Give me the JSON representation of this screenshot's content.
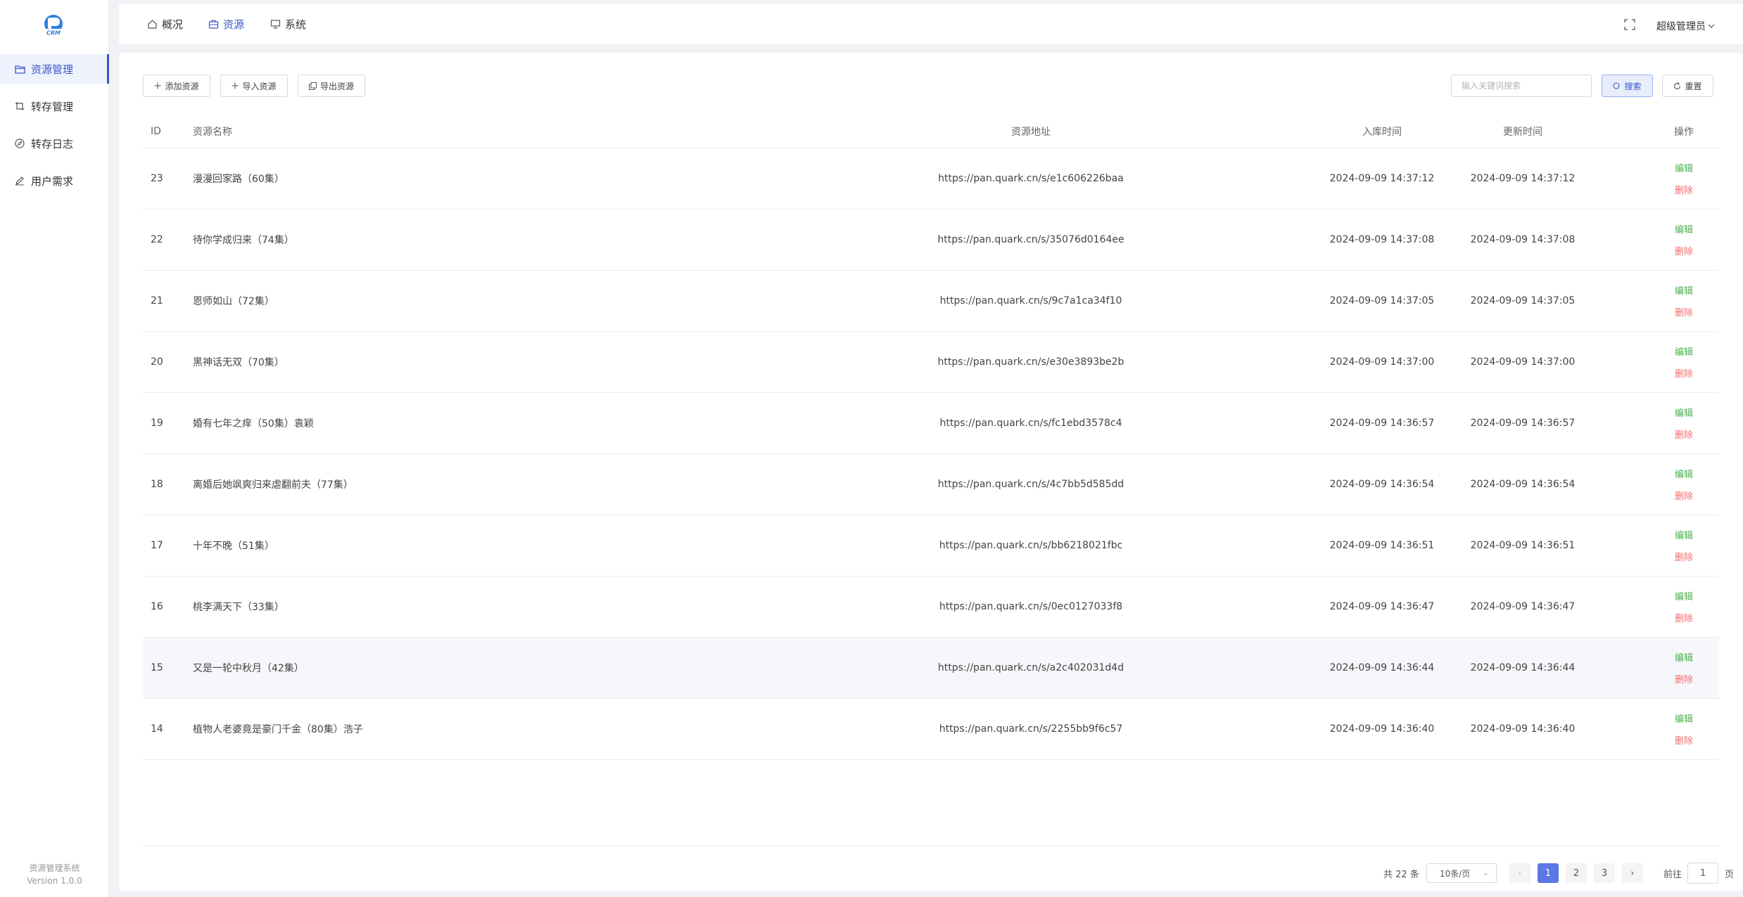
{
  "sidebar": {
    "logo_text": "CRM",
    "items": [
      {
        "label": "资源管理",
        "icon": "folder-icon"
      },
      {
        "label": "转存管理",
        "icon": "crop-icon"
      },
      {
        "label": "转存日志",
        "icon": "compass-icon"
      },
      {
        "label": "用户需求",
        "icon": "pen-icon"
      }
    ],
    "footer_name": "资源管理系统",
    "footer_version": "Version 1.0.0"
  },
  "topbar": {
    "tabs": [
      {
        "label": "概况",
        "icon": "home-icon"
      },
      {
        "label": "资源",
        "icon": "briefcase-icon"
      },
      {
        "label": "系统",
        "icon": "monitor-icon"
      }
    ],
    "user": "超级管理员"
  },
  "toolbar": {
    "add_label": "添加资源",
    "import_label": "导入资源",
    "export_label": "导出资源",
    "search_placeholder": "输入关键词搜索",
    "search_label": "搜索",
    "reset_label": "重置"
  },
  "table": {
    "headers": {
      "id": "ID",
      "name": "资源名称",
      "url": "资源地址",
      "created": "入库时间",
      "updated": "更新时间",
      "ops": "操作"
    },
    "edit_label": "编辑",
    "delete_label": "删除",
    "rows": [
      {
        "id": "23",
        "name": "漫漫回家路（60集）",
        "url": "https://pan.quark.cn/s/e1c606226baa",
        "created": "2024-09-09 14:37:12",
        "updated": "2024-09-09 14:37:12"
      },
      {
        "id": "22",
        "name": "待你学成归来（74集）",
        "url": "https://pan.quark.cn/s/35076d0164ee",
        "created": "2024-09-09 14:37:08",
        "updated": "2024-09-09 14:37:08"
      },
      {
        "id": "21",
        "name": "恩师如山（72集）",
        "url": "https://pan.quark.cn/s/9c7a1ca34f10",
        "created": "2024-09-09 14:37:05",
        "updated": "2024-09-09 14:37:05"
      },
      {
        "id": "20",
        "name": "黑神话无双（70集）",
        "url": "https://pan.quark.cn/s/e30e3893be2b",
        "created": "2024-09-09 14:37:00",
        "updated": "2024-09-09 14:37:00"
      },
      {
        "id": "19",
        "name": "婚有七年之痒（50集）袁颖",
        "url": "https://pan.quark.cn/s/fc1ebd3578c4",
        "created": "2024-09-09 14:36:57",
        "updated": "2024-09-09 14:36:57"
      },
      {
        "id": "18",
        "name": "离婚后她飒爽归来虐翻前夫（77集）",
        "url": "https://pan.quark.cn/s/4c7bb5d585dd",
        "created": "2024-09-09 14:36:54",
        "updated": "2024-09-09 14:36:54"
      },
      {
        "id": "17",
        "name": "十年不晚（51集）",
        "url": "https://pan.quark.cn/s/bb6218021fbc",
        "created": "2024-09-09 14:36:51",
        "updated": "2024-09-09 14:36:51"
      },
      {
        "id": "16",
        "name": "桃李满天下（33集）",
        "url": "https://pan.quark.cn/s/0ec0127033f8",
        "created": "2024-09-09 14:36:47",
        "updated": "2024-09-09 14:36:47"
      },
      {
        "id": "15",
        "name": "又是一轮中秋月（42集）",
        "url": "https://pan.quark.cn/s/a2c402031d4d",
        "created": "2024-09-09 14:36:44",
        "updated": "2024-09-09 14:36:44"
      },
      {
        "id": "14",
        "name": "植物人老婆竟是豪门千金（80集）浩子",
        "url": "https://pan.quark.cn/s/2255bb9f6c57",
        "created": "2024-09-09 14:36:40",
        "updated": "2024-09-09 14:36:40"
      }
    ]
  },
  "pagination": {
    "total_label": "共 22 条",
    "page_size": "10条/页",
    "prev": "‹",
    "next": "›",
    "pages": [
      "1",
      "2",
      "3"
    ],
    "goto_label": "前往",
    "goto_value": "1",
    "page_suffix": "页"
  },
  "colors": {
    "accent": "#3a56c9",
    "edit": "#4caf50",
    "delete": "#f56c6c",
    "page_active": "#5b78e6"
  }
}
